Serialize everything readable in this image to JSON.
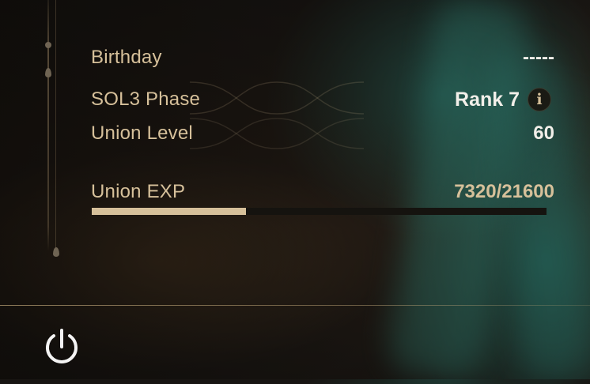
{
  "profile": {
    "birthday": {
      "label": "Birthday",
      "value": "-----"
    },
    "sol3_phase": {
      "label": "SOL3 Phase",
      "value": "Rank 7",
      "info_glyph": "i"
    },
    "union_level": {
      "label": "Union Level",
      "value": "60"
    },
    "union_exp": {
      "label": "Union EXP",
      "value": "7320/21600",
      "current": 7320,
      "max": 21600
    }
  },
  "footer": {
    "power_icon": "power-icon"
  },
  "colors": {
    "gold": "#d6c09a",
    "white": "#f2efe9",
    "bar_track": "#15130f"
  }
}
